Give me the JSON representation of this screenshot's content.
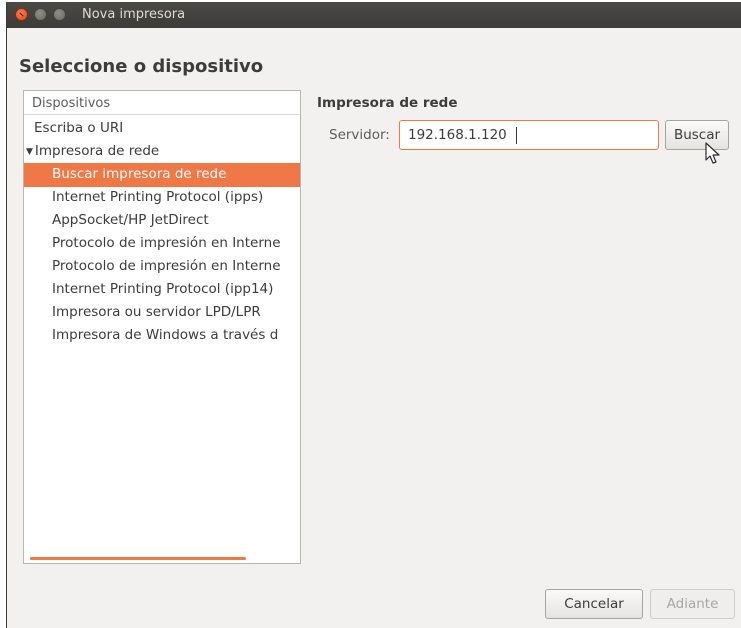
{
  "window": {
    "title": "Nova impresora",
    "heading": "Seleccione o dispositivo"
  },
  "devices": {
    "header": "Dispositivos",
    "items": [
      {
        "label": "Escriba o URI",
        "level": 0
      },
      {
        "label": "Impresora de rede",
        "level": 0,
        "expanded": true
      },
      {
        "label": "Buscar impresora de rede",
        "level": 1,
        "selected": true
      },
      {
        "label": "Internet Printing Protocol (ipps)",
        "level": 1
      },
      {
        "label": "AppSocket/HP JetDirect",
        "level": 1
      },
      {
        "label": "Protocolo de impresión en Interne",
        "level": 1
      },
      {
        "label": "Protocolo de impresión en Interne",
        "level": 1
      },
      {
        "label": "Internet Printing Protocol (ipp14)",
        "level": 1
      },
      {
        "label": "Impresora ou servidor LPD/LPR",
        "level": 1
      },
      {
        "label": "Impresora de Windows a través d",
        "level": 1
      }
    ]
  },
  "network_printer": {
    "title": "Impresora de rede",
    "server_label": "Servidor:",
    "server_value": "192.168.1.120",
    "search_button": "Buscar"
  },
  "footer": {
    "cancel_button": "Cancelar",
    "next_button": "Adiante"
  },
  "colors": {
    "accent": "#f07746",
    "titlebar": "#3c3b37",
    "background": "#f2f1f0"
  }
}
